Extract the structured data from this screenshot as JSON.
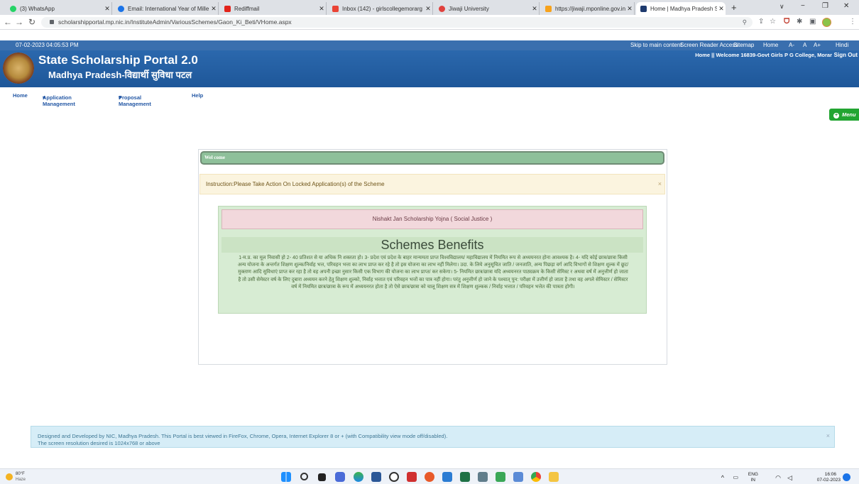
{
  "browser": {
    "tabs": [
      {
        "label": "(3) WhatsApp",
        "color": "#25d366"
      },
      {
        "label": "Email: International Year of Mille",
        "color": "#1a73e8"
      },
      {
        "label": "Rediffmail",
        "color": "#e2231a"
      },
      {
        "label": "Inbox (142) - girlscollegemorarg",
        "color": "#ea4335"
      },
      {
        "label": "Jiwaji University",
        "color": "#e0413d"
      },
      {
        "label": "https://jiwaji.mponline.gov.in/p",
        "color": "#f7a21b"
      },
      {
        "label": "Home | Madhya Pradesh Schola",
        "color": "#1e3a6e"
      }
    ],
    "new_tab": "+",
    "window_controls": [
      "∨",
      "−",
      "❐",
      "✕"
    ],
    "url": "scholarshipportal.mp.nic.in/InstituteAdmin/VariousSchemes/Gaon_Ki_Beti/VHome.aspx"
  },
  "site": {
    "datetime": "07-02-2023 04:05:53 PM",
    "top_links": [
      "Skip to main content",
      "Screen Reader Access",
      "Sitemap",
      "Home",
      "A-",
      "A",
      "A+",
      "Hindi"
    ],
    "title": "State Scholarship Portal 2.0",
    "subtitle": "Madhya Pradesh-विद्यार्थी सुविधा पटल",
    "welcome": "Home || Welcome 16839-Govt Girls P G College, Morar",
    "sign_out": "Sign Out",
    "menu": [
      "Home",
      "Application Management",
      "Proposal Management",
      "Help"
    ],
    "menu_button": "Menu"
  },
  "panel": {
    "welcome_bar": "Wel come",
    "instruction": "Instruction:Please Take Action On Locked Application(s) of the Scheme",
    "close": "×",
    "scheme_name": "Nishakt Jan Scholarship Yojna ( Social Justice )",
    "benefits_heading": "Schemes Benefits",
    "benefits_text": "1-म.प्र. का मूल निवासी हो 2- 40 प्रतिशत से या अधिक नि शक्तता हो। 3- प्रदेश एवं प्रदेश के बाहर मान्यमता प्राप्त विश्वविद्यालय/ महाविद्यालय में नियमित रूप से अध्ययनरत होना आवश्यक है। 4- यदि कोई छात्र/छात्रा किसी अन्य योजना के अन्तर्गत शिक्षण शुल्क/निर्वाह भत्त, परिवहन भत्ता का लाभ प्राप्त कर रहे है तो इस योजना का लाभ नहीं मिलेगा। उदा. के लिये अनुसूचित जाति / जनजाति, अन्य पिछड़ा वर्ग आदि विभागों से शिक्षण शुल्क में छूट/मुक्ताण आदि सुविधाएं प्राप्त कर रहा है तो वह अपनी इच्छा नुसार किसी एक विभाग की योजना का लाभ प्राप्त/ कर सकेगा। 5- नियमित छात्र/छात्रा यदि अध्ययनरत पाठ्यक्रम के किसी सेमिस्ट र अथवा वर्ष में अनुत्तीर्ण हो जाता है तो उसी सेमेस्टर वर्ष के लिए दुबारा अध्ययन करने हेतु शिक्षण शुल्को, निर्वाह भत्तात एवं परिवहन भत्तों का पात्र नहीं होगा। परंतु अनुत्तीर्ण हो जाने के पश्चात् पुन: परीक्षा में उत्तीर्ण हो जाता है तथा वह अगले सेमिस्टर / सेमिस्टर वर्ष में नियमित छात्र/छात्रा के रूप में अध्ययनरत होता है तो ऐसे छात्र/छात्रा को चालू शिक्षण सत्र में शिक्षण शुल्कक / निर्वाह भत्तात / परिवहन भत्तेत की पात्रता होगी।"
  },
  "footer": {
    "line1": "Designed and Developed by NIC, Madhya Pradesh. This Portal is best viewed in FireFox, Chrome, Opera, Internet Explorer 8 or + (with Compatibility view mode off/disabled).",
    "line2": "The screen resolution desired is 1024x768 or above",
    "close": "×"
  },
  "taskbar": {
    "temp": "80°F",
    "weather": "Haze",
    "lang": "ENG",
    "region": "IN",
    "time": "16:06",
    "date": "07-02-2023"
  }
}
